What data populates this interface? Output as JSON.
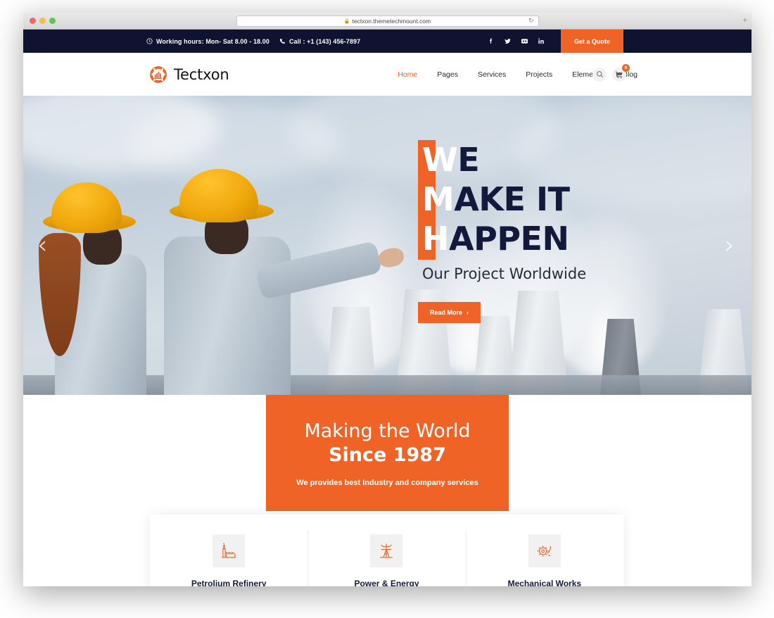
{
  "browser": {
    "url": "tectxon.themetechmount.com",
    "lock_icon": "lock-icon",
    "reload_icon": "reload-icon",
    "new_tab_label": "+",
    "traffic_lights": [
      "close",
      "minimize",
      "maximize"
    ]
  },
  "topbar": {
    "working_hours": "Working hours: Mon- Sat 8.00 - 18.00",
    "clock_icon": "clock-icon",
    "phone_icon": "phone-icon",
    "phone": "Call : +1 (143) 456-7897",
    "socials": [
      {
        "name": "facebook-icon",
        "label": "f"
      },
      {
        "name": "twitter-icon",
        "label": "t"
      },
      {
        "name": "flickr-icon",
        "label": "fl"
      },
      {
        "name": "linkedin-icon",
        "label": "in"
      }
    ],
    "quote_button": "Get a Quote",
    "bg_color": "#0e1330",
    "accent_color": "#ef6327"
  },
  "header": {
    "logo_text": "Tectxon",
    "logo_icon": "gear-factory-logo-icon",
    "nav": [
      {
        "label": "Home",
        "active": true
      },
      {
        "label": "Pages",
        "active": false
      },
      {
        "label": "Services",
        "active": false
      },
      {
        "label": "Projects",
        "active": false
      },
      {
        "label": "Elements",
        "active": false
      },
      {
        "label": "Blog",
        "active": false
      }
    ],
    "search_icon": "search-icon",
    "cart_icon": "cart-icon",
    "cart_count": "0"
  },
  "hero": {
    "headline_line1_first": "W",
    "headline_line1_rest": "E",
    "headline_line2_first": "M",
    "headline_line2_rest": "AKE IT",
    "headline_line3_first": "H",
    "headline_line3_rest": "APPEN",
    "subheadline": "Our Project Worldwide",
    "cta_label": "Read More",
    "cta_arrow": "›",
    "prev_arrow": "‹",
    "next_arrow": "›",
    "accent_color": "#ef6327",
    "headline_color": "#12193b"
  },
  "promo": {
    "line1": "Making the World",
    "line2": "Since 1987",
    "subtitle": "We provides best Industry and company services",
    "bg_color": "#ef6327"
  },
  "services": [
    {
      "title": "Petrolium Refinery",
      "icon": "factory-icon"
    },
    {
      "title": "Power & Energy",
      "icon": "power-pylon-icon"
    },
    {
      "title": "Mechanical Works",
      "icon": "gear-wrench-icon"
    }
  ]
}
